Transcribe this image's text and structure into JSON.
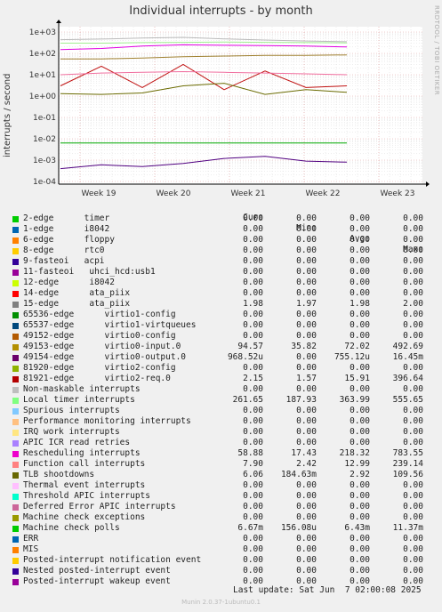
{
  "chart_data": {
    "type": "line",
    "title": "Individual interrupts - by month",
    "ylabel": "interrupts / second",
    "yscale": "log",
    "ylim": [
      0.0001,
      1000
    ],
    "ytick_labels": [
      "1e+03",
      "1e+02",
      "1e+01",
      "1e+00",
      "1e-01",
      "1e-02",
      "1e-03",
      "1e-04"
    ],
    "ytick_values": [
      1000,
      100,
      10,
      1,
      0.1,
      0.01,
      0.001,
      0.0001
    ],
    "xtick_labels": [
      "Week 19",
      "Week 20",
      "Week 21",
      "Week 22",
      "Week 23"
    ],
    "grid": true,
    "series": [
      {
        "name": "Non-maskable interrupts",
        "color": "#bbbbbb",
        "values": [
          440,
          470,
          520,
          560,
          480,
          420,
          380,
          350
        ]
      },
      {
        "name": "Local timer interrupts",
        "color": "#a0f090",
        "values": [
          300,
          300,
          320,
          330,
          340,
          330,
          320,
          310
        ]
      },
      {
        "name": "Rescheduling interrupts",
        "color": "#e000e0",
        "values": [
          150,
          170,
          220,
          250,
          240,
          230,
          220,
          200
        ]
      },
      {
        "name": "49153-edge virtio0-input.0",
        "color": "#a08030",
        "values": [
          55,
          55,
          60,
          70,
          75,
          80,
          80,
          85
        ]
      },
      {
        "name": "81921-edge virtio2-req.0",
        "color": "#c01010",
        "values": [
          3,
          25,
          2.5,
          30,
          2,
          15,
          2.5,
          3
        ]
      },
      {
        "name": "Function call interrupts",
        "color": "#f070a0",
        "values": [
          10,
          12,
          13,
          14,
          13,
          12,
          11,
          10
        ]
      },
      {
        "name": "TLB shootdowns",
        "color": "#6a6a00",
        "values": [
          1.3,
          1.2,
          1.4,
          3,
          4,
          1.2,
          2,
          1.5
        ]
      },
      {
        "name": "Machine check polls",
        "color": "#00aa00",
        "values": [
          0.0064,
          0.0064,
          0.0064,
          0.0064,
          0.0064,
          0.0064,
          0.0064,
          0.0064
        ]
      },
      {
        "name": "49154-edge virtio0-output.0",
        "color": "#500080",
        "values": [
          0.0004,
          0.0006,
          0.0005,
          0.0007,
          0.0012,
          0.0015,
          0.0009,
          0.0008
        ]
      }
    ]
  },
  "vertical_note": "RRDTOOL / TOBI OETIKER",
  "legend": {
    "headers": {
      "cur": "Cur:",
      "min": "Min:",
      "avg": "Avg:",
      "max": "Max:"
    },
    "rows": [
      {
        "name": "2-edge      timer",
        "color": "#00cc00",
        "cur": "0.00",
        "min": "0.00",
        "avg": "0.00",
        "max": "0.00"
      },
      {
        "name": "1-edge      i8042",
        "color": "#0066b3",
        "cur": "0.00",
        "min": "0.00",
        "avg": "0.00",
        "max": "0.00"
      },
      {
        "name": "6-edge      floppy",
        "color": "#ff8000",
        "cur": "0.00",
        "min": "0.00",
        "avg": "0.00",
        "max": "0.00"
      },
      {
        "name": "8-edge      rtc0",
        "color": "#ffcc00",
        "cur": "0.00",
        "min": "0.00",
        "avg": "0.00",
        "max": "0.00"
      },
      {
        "name": "9-fasteoi   acpi",
        "color": "#330099",
        "cur": "0.00",
        "min": "0.00",
        "avg": "0.00",
        "max": "0.00"
      },
      {
        "name": "11-fasteoi   uhci_hcd:usb1",
        "color": "#990099",
        "cur": "0.00",
        "min": "0.00",
        "avg": "0.00",
        "max": "0.00"
      },
      {
        "name": "12-edge      i8042",
        "color": "#ccff00",
        "cur": "0.00",
        "min": "0.00",
        "avg": "0.00",
        "max": "0.00"
      },
      {
        "name": "14-edge      ata_piix",
        "color": "#ff0000",
        "cur": "0.00",
        "min": "0.00",
        "avg": "0.00",
        "max": "0.00"
      },
      {
        "name": "15-edge      ata_piix",
        "color": "#808080",
        "cur": "1.98",
        "min": "1.97",
        "avg": "1.98",
        "max": "2.00"
      },
      {
        "name": "65536-edge      virtio1-config",
        "color": "#008f00",
        "cur": "0.00",
        "min": "0.00",
        "avg": "0.00",
        "max": "0.00"
      },
      {
        "name": "65537-edge      virtio1-virtqueues",
        "color": "#00487d",
        "cur": "0.00",
        "min": "0.00",
        "avg": "0.00",
        "max": "0.00"
      },
      {
        "name": "49152-edge      virtio0-config",
        "color": "#b35a00",
        "cur": "0.00",
        "min": "0.00",
        "avg": "0.00",
        "max": "0.00"
      },
      {
        "name": "49153-edge      virtio0-input.0",
        "color": "#b38f00",
        "cur": "94.57",
        "min": "35.82",
        "avg": "72.02",
        "max": "492.69"
      },
      {
        "name": "49154-edge      virtio0-output.0",
        "color": "#6b006b",
        "cur": "968.52u",
        "min": "0.00",
        "avg": "755.12u",
        "max": "16.45m"
      },
      {
        "name": "81920-edge      virtio2-config",
        "color": "#8fb300",
        "cur": "0.00",
        "min": "0.00",
        "avg": "0.00",
        "max": "0.00"
      },
      {
        "name": "81921-edge      virtio2-req.0",
        "color": "#b30000",
        "cur": "2.15",
        "min": "1.57",
        "avg": "15.91",
        "max": "396.64"
      },
      {
        "name": "Non-maskable interrupts",
        "color": "#bebebe",
        "cur": "0.00",
        "min": "0.00",
        "avg": "0.00",
        "max": "0.00"
      },
      {
        "name": "Local timer interrupts",
        "color": "#80ff80",
        "cur": "261.65",
        "min": "187.93",
        "avg": "363.99",
        "max": "555.65"
      },
      {
        "name": "Spurious interrupts",
        "color": "#80c9ff",
        "cur": "0.00",
        "min": "0.00",
        "avg": "0.00",
        "max": "0.00"
      },
      {
        "name": "Performance monitoring interrupts",
        "color": "#ffc080",
        "cur": "0.00",
        "min": "0.00",
        "avg": "0.00",
        "max": "0.00"
      },
      {
        "name": "IRQ work interrupts",
        "color": "#ffe680",
        "cur": "0.00",
        "min": "0.00",
        "avg": "0.00",
        "max": "0.00"
      },
      {
        "name": "APIC ICR read retries",
        "color": "#aa80ff",
        "cur": "0.00",
        "min": "0.00",
        "avg": "0.00",
        "max": "0.00"
      },
      {
        "name": "Rescheduling interrupts",
        "color": "#ee00cc",
        "cur": "58.88",
        "min": "17.43",
        "avg": "218.32",
        "max": "783.55"
      },
      {
        "name": "Function call interrupts",
        "color": "#ff8080",
        "cur": "7.90",
        "min": "2.42",
        "avg": "12.99",
        "max": "239.14"
      },
      {
        "name": "TLB shootdowns",
        "color": "#666600",
        "cur": "6.06",
        "min": "184.63m",
        "avg": "2.92",
        "max": "109.56"
      },
      {
        "name": "Thermal event interrupts",
        "color": "#ffbfff",
        "cur": "0.00",
        "min": "0.00",
        "avg": "0.00",
        "max": "0.00"
      },
      {
        "name": "Threshold APIC interrupts",
        "color": "#00ffcc",
        "cur": "0.00",
        "min": "0.00",
        "avg": "0.00",
        "max": "0.00"
      },
      {
        "name": "Deferred Error APIC interrupts",
        "color": "#cc6699",
        "cur": "0.00",
        "min": "0.00",
        "avg": "0.00",
        "max": "0.00"
      },
      {
        "name": "Machine check exceptions",
        "color": "#999900",
        "cur": "0.00",
        "min": "0.00",
        "avg": "0.00",
        "max": "0.00"
      },
      {
        "name": "Machine check polls",
        "color": "#00cc00",
        "cur": "6.67m",
        "min": "156.08u",
        "avg": "6.43m",
        "max": "11.37m"
      },
      {
        "name": "ERR",
        "color": "#0066b3",
        "cur": "0.00",
        "min": "0.00",
        "avg": "0.00",
        "max": "0.00"
      },
      {
        "name": "MIS",
        "color": "#ff8000",
        "cur": "0.00",
        "min": "0.00",
        "avg": "0.00",
        "max": "0.00"
      },
      {
        "name": "Posted-interrupt notification event",
        "color": "#ffcc00",
        "cur": "0.00",
        "min": "0.00",
        "avg": "0.00",
        "max": "0.00"
      },
      {
        "name": "Nested posted-interrupt event",
        "color": "#330099",
        "cur": "0.00",
        "min": "0.00",
        "avg": "0.00",
        "max": "0.00"
      },
      {
        "name": "Posted-interrupt wakeup event",
        "color": "#990099",
        "cur": "0.00",
        "min": "0.00",
        "avg": "0.00",
        "max": "0.00"
      }
    ]
  },
  "last_update": "Last update: Sat Jun  7 02:00:08 2025",
  "footer": "Munin 2.0.37-1ubuntu0.1"
}
